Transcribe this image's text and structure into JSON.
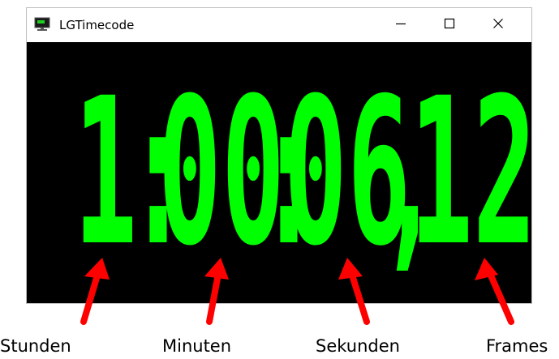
{
  "window": {
    "title": "LGTimecode",
    "controls": {
      "minimize_icon": "minimize-icon",
      "maximize_icon": "maximize-icon",
      "close_icon": "close-icon"
    }
  },
  "timecode": {
    "hours": "1",
    "sep1": ":",
    "minutes": "00",
    "sep2": ":",
    "seconds": "06",
    "sep3": ",",
    "frames": "12",
    "color": "#00ff00",
    "background": "#000000"
  },
  "annotations": {
    "arrow_color": "#ff0000",
    "labels": {
      "hours": "Stunden",
      "minutes": "Minuten",
      "seconds": "Sekunden",
      "frames": "Frames"
    }
  }
}
